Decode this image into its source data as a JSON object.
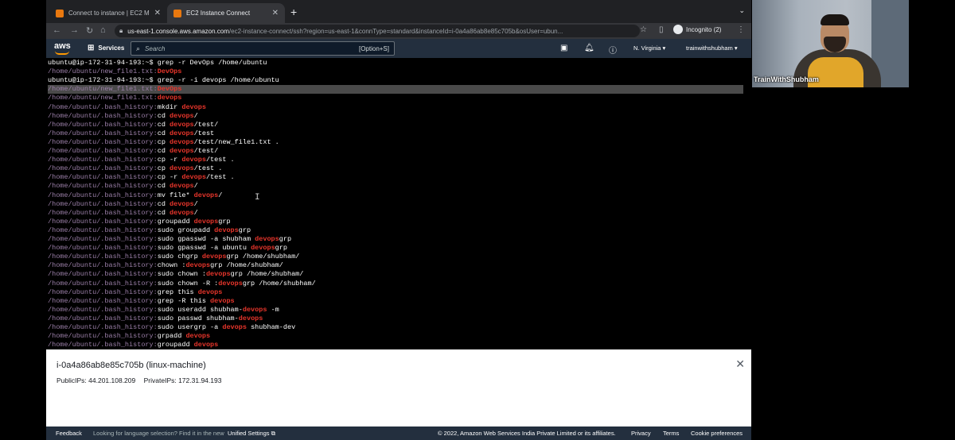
{
  "browser": {
    "tabs": [
      {
        "title": "Connect to instance | EC2 Man",
        "close": "✕",
        "active": false
      },
      {
        "title": "EC2 Instance Connect",
        "close": "✕",
        "active": true
      }
    ],
    "new_tab": "+",
    "tab_menu": "⌄",
    "url_host": "us-east-1.console.aws.amazon.com",
    "url_rest": "/ec2-instance-connect/ssh?region=us-east-1&connType=standard&instanceId=i-0a4a86ab8e85c705b&osUser=ubun...",
    "incognito_label": "Incognito (2)"
  },
  "aws_nav": {
    "logo": "aws",
    "services_label": "Services",
    "search_placeholder": "Search",
    "search_shortcut": "[Option+S]",
    "region": "N. Virginia ▾",
    "account": "trainwithshubham ▾"
  },
  "terminal": {
    "lines": [
      {
        "pre": "",
        "segs": [
          [
            "ubuntu@ip-172-31-94-193:~$ grep -r DevOps /home/ubuntu",
            ""
          ]
        ],
        "hl": false
      },
      {
        "pre": "/home/ubuntu/new_file1.txt:",
        "segs": [
          [
            "DevOps",
            "m"
          ]
        ],
        "hl": false
      },
      {
        "pre": "",
        "segs": [
          [
            "ubuntu@ip-172-31-94-193:~$ grep -r -i devops /home/ubuntu",
            ""
          ]
        ],
        "hl": false
      },
      {
        "pre": "/home/ubuntu/new_file1.txt:",
        "segs": [
          [
            "DevOps",
            "m"
          ]
        ],
        "hl": true
      },
      {
        "pre": "/home/ubuntu/new_file1.txt:",
        "segs": [
          [
            "devops",
            "m"
          ]
        ],
        "hl": false
      },
      {
        "pre": "/home/ubuntu/.bash_history:",
        "segs": [
          [
            "mkdir ",
            ""
          ],
          [
            "devops",
            "m"
          ]
        ],
        "hl": false
      },
      {
        "pre": "/home/ubuntu/.bash_history:",
        "segs": [
          [
            "cd ",
            ""
          ],
          [
            "devops",
            "m"
          ],
          [
            "/",
            ""
          ]
        ],
        "hl": false
      },
      {
        "pre": "/home/ubuntu/.bash_history:",
        "segs": [
          [
            "cd ",
            ""
          ],
          [
            "devops",
            "m"
          ],
          [
            "/test/",
            ""
          ]
        ],
        "hl": false
      },
      {
        "pre": "/home/ubuntu/.bash_history:",
        "segs": [
          [
            "cd ",
            ""
          ],
          [
            "devops",
            "m"
          ],
          [
            "/test",
            ""
          ]
        ],
        "hl": false
      },
      {
        "pre": "/home/ubuntu/.bash_history:",
        "segs": [
          [
            "cp ",
            ""
          ],
          [
            "devops",
            "m"
          ],
          [
            "/test/new_file1.txt .",
            ""
          ]
        ],
        "hl": false
      },
      {
        "pre": "/home/ubuntu/.bash_history:",
        "segs": [
          [
            "cd ",
            ""
          ],
          [
            "devops",
            "m"
          ],
          [
            "/test/",
            ""
          ]
        ],
        "hl": false
      },
      {
        "pre": "/home/ubuntu/.bash_history:",
        "segs": [
          [
            "cp -r ",
            ""
          ],
          [
            "devops",
            "m"
          ],
          [
            "/test .",
            ""
          ]
        ],
        "hl": false
      },
      {
        "pre": "/home/ubuntu/.bash_history:",
        "segs": [
          [
            "cp ",
            ""
          ],
          [
            "devops",
            "m"
          ],
          [
            "/test .",
            ""
          ]
        ],
        "hl": false
      },
      {
        "pre": "/home/ubuntu/.bash_history:",
        "segs": [
          [
            "cp -r ",
            ""
          ],
          [
            "devops",
            "m"
          ],
          [
            "/test .",
            ""
          ]
        ],
        "hl": false
      },
      {
        "pre": "/home/ubuntu/.bash_history:",
        "segs": [
          [
            "cd ",
            ""
          ],
          [
            "devops",
            "m"
          ],
          [
            "/",
            ""
          ]
        ],
        "hl": false
      },
      {
        "pre": "/home/ubuntu/.bash_history:",
        "segs": [
          [
            "mv file* ",
            ""
          ],
          [
            "devops",
            "m"
          ],
          [
            "/",
            ""
          ]
        ],
        "hl": false
      },
      {
        "pre": "/home/ubuntu/.bash_history:",
        "segs": [
          [
            "cd ",
            ""
          ],
          [
            "devops",
            "m"
          ],
          [
            "/",
            ""
          ]
        ],
        "hl": false
      },
      {
        "pre": "/home/ubuntu/.bash_history:",
        "segs": [
          [
            "cd ",
            ""
          ],
          [
            "devops",
            "m"
          ],
          [
            "/",
            ""
          ]
        ],
        "hl": false
      },
      {
        "pre": "/home/ubuntu/.bash_history:",
        "segs": [
          [
            "groupadd ",
            ""
          ],
          [
            "devops",
            "m"
          ],
          [
            "grp",
            ""
          ]
        ],
        "hl": false
      },
      {
        "pre": "/home/ubuntu/.bash_history:",
        "segs": [
          [
            "sudo groupadd ",
            ""
          ],
          [
            "devops",
            "m"
          ],
          [
            "grp",
            ""
          ]
        ],
        "hl": false
      },
      {
        "pre": "/home/ubuntu/.bash_history:",
        "segs": [
          [
            "sudo gpasswd -a shubham ",
            ""
          ],
          [
            "devops",
            "m"
          ],
          [
            "grp",
            ""
          ]
        ],
        "hl": false
      },
      {
        "pre": "/home/ubuntu/.bash_history:",
        "segs": [
          [
            "sudo gpasswd -a ubuntu ",
            ""
          ],
          [
            "devops",
            "m"
          ],
          [
            "grp",
            ""
          ]
        ],
        "hl": false
      },
      {
        "pre": "/home/ubuntu/.bash_history:",
        "segs": [
          [
            "sudo chgrp ",
            ""
          ],
          [
            "devops",
            "m"
          ],
          [
            "grp /home/shubham/",
            ""
          ]
        ],
        "hl": false
      },
      {
        "pre": "/home/ubuntu/.bash_history:",
        "segs": [
          [
            "chown :",
            ""
          ],
          [
            "devops",
            "m"
          ],
          [
            "grp /home/shubham/",
            ""
          ]
        ],
        "hl": false
      },
      {
        "pre": "/home/ubuntu/.bash_history:",
        "segs": [
          [
            "sudo chown :",
            ""
          ],
          [
            "devops",
            "m"
          ],
          [
            "grp /home/shubham/",
            ""
          ]
        ],
        "hl": false
      },
      {
        "pre": "/home/ubuntu/.bash_history:",
        "segs": [
          [
            "sudo chown -R :",
            ""
          ],
          [
            "devops",
            "m"
          ],
          [
            "grp /home/shubham/",
            ""
          ]
        ],
        "hl": false
      },
      {
        "pre": "/home/ubuntu/.bash_history:",
        "segs": [
          [
            "grep this ",
            ""
          ],
          [
            "devops",
            "m"
          ]
        ],
        "hl": false
      },
      {
        "pre": "/home/ubuntu/.bash_history:",
        "segs": [
          [
            "grep -R this ",
            ""
          ],
          [
            "devops",
            "m"
          ]
        ],
        "hl": false
      },
      {
        "pre": "/home/ubuntu/.bash_history:",
        "segs": [
          [
            "sudo useradd shubham-",
            ""
          ],
          [
            "devops",
            "m"
          ],
          [
            " -m",
            ""
          ]
        ],
        "hl": false
      },
      {
        "pre": "/home/ubuntu/.bash_history:",
        "segs": [
          [
            "sudo passwd shubham-",
            ""
          ],
          [
            "devops",
            "m"
          ]
        ],
        "hl": false
      },
      {
        "pre": "/home/ubuntu/.bash_history:",
        "segs": [
          [
            "sudo usergrp -a ",
            ""
          ],
          [
            "devops",
            "m"
          ],
          [
            " shubham-dev",
            ""
          ]
        ],
        "hl": false
      },
      {
        "pre": "/home/ubuntu/.bash_history:",
        "segs": [
          [
            "grpadd ",
            ""
          ],
          [
            "devops",
            "m"
          ]
        ],
        "hl": false
      },
      {
        "pre": "/home/ubuntu/.bash_history:",
        "segs": [
          [
            "groupadd ",
            ""
          ],
          [
            "devops",
            "m"
          ]
        ],
        "hl": false
      }
    ],
    "highlight_color": "#4a4a4a",
    "match_color": "#e8352b"
  },
  "instance_panel": {
    "title": "i-0a4a86ab8e85c705b (linux-machine)",
    "public_ips": "PublicIPs: 44.201.108.209",
    "private_ips": "PrivateIPs: 172.31.94.193",
    "close": "✕"
  },
  "footer": {
    "feedback": "Feedback",
    "language_prompt": "Looking for language selection? Find it in the new",
    "unified_settings": "Unified Settings ⧉",
    "copyright": "© 2022, Amazon Web Services India Private Limited or its affiliates.",
    "privacy": "Privacy",
    "terms": "Terms",
    "cookie": "Cookie preferences"
  },
  "webcam": {
    "label": "TrainWithShubham"
  },
  "colors": {
    "aws_nav_bg": "#232f3e",
    "aws_orange": "#ff9900",
    "path_prefix": "#9b7fa8"
  }
}
